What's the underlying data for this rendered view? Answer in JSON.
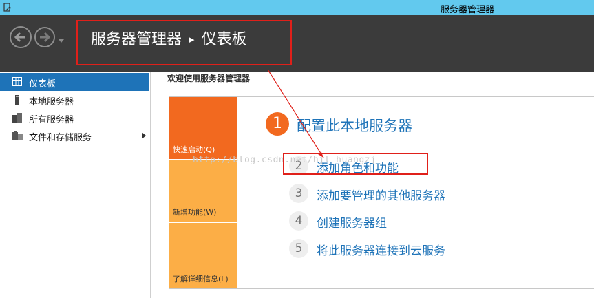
{
  "window": {
    "title": "服务器管理器"
  },
  "header": {
    "breadcrumb_root": "服务器管理器",
    "breadcrumb_current": "仪表板"
  },
  "sidebar": {
    "items": [
      {
        "label": "仪表板",
        "icon": "dashboard-icon",
        "active": true
      },
      {
        "label": "本地服务器",
        "icon": "server-icon"
      },
      {
        "label": "所有服务器",
        "icon": "servers-icon"
      },
      {
        "label": "文件和存储服务",
        "icon": "storage-icon",
        "has_submenu": true
      }
    ]
  },
  "main": {
    "welcome": "欢迎使用服务器管理器",
    "tiles": [
      {
        "label": "快速启动(Q)"
      },
      {
        "label": "新增功能(W)"
      },
      {
        "label": "了解详细信息(L)"
      }
    ],
    "steps": [
      {
        "number": "1",
        "label": "配置此本地服务器"
      },
      {
        "number": "2",
        "label": "添加角色和功能"
      },
      {
        "number": "3",
        "label": "添加要管理的其他服务器"
      },
      {
        "number": "4",
        "label": "创建服务器组"
      },
      {
        "number": "5",
        "label": "将此服务器连接到云服务"
      }
    ]
  },
  "watermark": "http://blog.csdn.net/hjl_huangzj",
  "colors": {
    "accent": "#1e73b8",
    "orange": "#f2691f",
    "amber": "#fcae46",
    "highlight": "#e0201a"
  }
}
